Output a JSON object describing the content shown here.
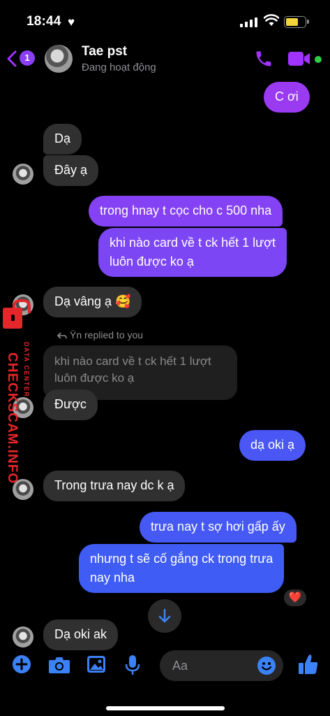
{
  "status_bar": {
    "time": "18:44",
    "heart": "♥"
  },
  "header": {
    "unread_count": "1",
    "contact_name": "Tae pst",
    "presence": "Đang hoạt động"
  },
  "messages": [
    {
      "id": "m1",
      "side": "out",
      "text": "C ơi"
    },
    {
      "id": "m2",
      "side": "in",
      "text": "Dạ"
    },
    {
      "id": "m3",
      "side": "in",
      "text": "Đây ạ"
    },
    {
      "id": "m4",
      "side": "out",
      "text": "trong hnay t cọc cho c 500 nha"
    },
    {
      "id": "m5",
      "side": "out",
      "lines": [
        "khi nào card về t ck hết 1 lượt",
        "luôn được ko ạ"
      ]
    },
    {
      "id": "m6",
      "side": "in",
      "text": "Dạ vâng ạ 🥰"
    },
    {
      "id": "m7",
      "side": "in",
      "reply_label": "Ÿn replied to you",
      "quoted_lines": [
        "khi nào card về t ck hết 1 lượt",
        "luôn được ko ạ"
      ],
      "text": "Được"
    },
    {
      "id": "m8",
      "side": "out",
      "text": "dạ oki ạ"
    },
    {
      "id": "m9",
      "side": "in",
      "text": "Trong trưa nay dc k ạ"
    },
    {
      "id": "m10",
      "side": "out",
      "text": "trưa nay t sợ hơi gấp ấy"
    },
    {
      "id": "m11",
      "side": "out",
      "lines": [
        "nhưng t sẽ cố gắng ck trong trưa",
        "nay nha"
      ],
      "reaction": "❤️"
    },
    {
      "id": "m12",
      "side": "in",
      "text": "Dạ oki ak"
    }
  ],
  "watermark": {
    "brand": "CHECKSCAM.INFO",
    "tagline": "DATA CENTER"
  },
  "composer": {
    "placeholder": "Aa"
  },
  "colors": {
    "accent": "#a033ff",
    "out_top": "#8e3bf7",
    "out_bottom": "#3f5cf5",
    "incoming": "#303030",
    "online": "#31cc46",
    "watermark": "#e5262b"
  },
  "icons": [
    "back-chevron-icon",
    "phone-icon",
    "video-camera-icon",
    "add-icon",
    "camera-icon",
    "gallery-icon",
    "microphone-icon",
    "emoji-icon",
    "thumbs-up-icon",
    "arrow-down-icon"
  ]
}
